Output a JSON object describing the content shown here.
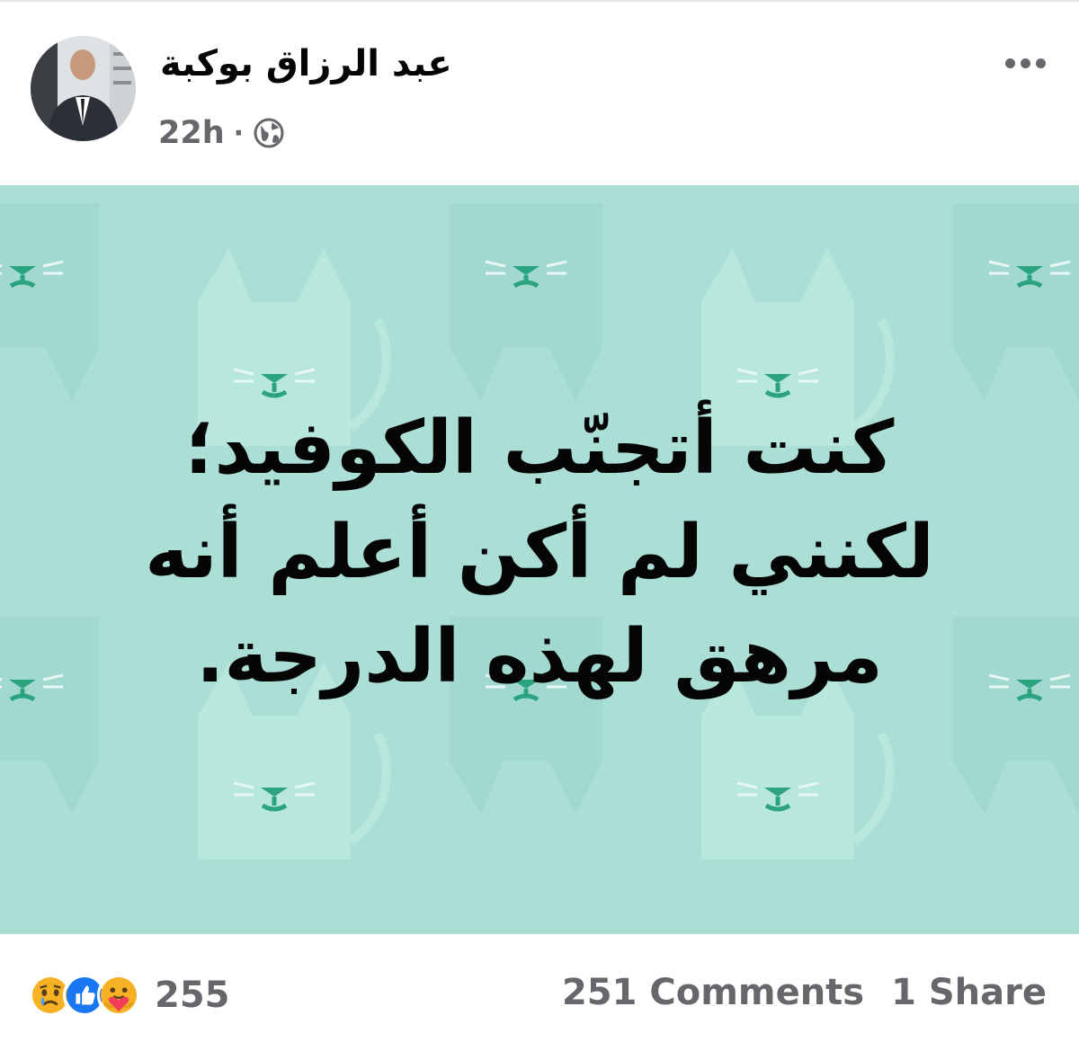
{
  "post": {
    "author_name": "عبد الرزاق بوكبة",
    "timestamp": "22h",
    "separator": "·",
    "privacy_icon": "globe-icon",
    "more_icon": "more-options-icon",
    "text_lines": [
      "كنت أتجنّب الكوفيد؛",
      "لكنني لم أكن أعلم أنه",
      "مرهق لهذه الدرجة."
    ],
    "background_color": "#abdfd6",
    "pattern_icon": "cat-pattern"
  },
  "reactions": {
    "icons": [
      "sad-reaction-icon",
      "like-reaction-icon",
      "care-reaction-icon"
    ],
    "count": "255"
  },
  "stats": {
    "comments": "251 Comments",
    "shares": "1 Share"
  },
  "colors": {
    "like_blue": "#1877f2",
    "meta_gray": "#65676b",
    "reaction_yellow": "#f7b125"
  }
}
